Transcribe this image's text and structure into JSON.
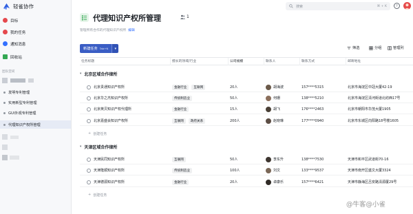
{
  "app": {
    "name": "轻雀协作"
  },
  "nav": [
    {
      "label": "目标",
      "color": "#e5484d"
    },
    {
      "label": "我的任务",
      "color": "#e5484d"
    },
    {
      "label": "通知消息",
      "color": "#3370ff"
    },
    {
      "label": "回收站",
      "color": "#34a853"
    }
  ],
  "sidebar": {
    "section_label": "团队空间",
    "projects": [
      {
        "label": "发明专利管理",
        "active": false
      },
      {
        "label": "实用新型专利管理",
        "active": false
      },
      {
        "label": "GUI外观专利管理",
        "active": false
      },
      {
        "label": "代理知识产权所管理",
        "active": true
      }
    ]
  },
  "topbar": {
    "search_placeholder": "搜索",
    "search_shortcut": "⌘ + K",
    "help_label": "?"
  },
  "header": {
    "title": "代理知识产权所管理",
    "member_count": "1",
    "subtitle": "管理所有合作的代理知识产权所",
    "edit_label": "编辑"
  },
  "toolbar": {
    "new_task_label": "新建任务",
    "new_task_shortcut": "Tab+N",
    "filter_label": "筛选",
    "group_label": "分组",
    "manage_columns_label": "管理列"
  },
  "table": {
    "columns": [
      "任务标题",
      "擅长的领域/行业",
      "公司规模",
      "联系人",
      "联系方式",
      "邮寄地址"
    ],
    "add_task_label": "创建任务",
    "groups": [
      {
        "name": "北京区域合作律所",
        "rows": [
          {
            "title": "北京贵通知识产权所",
            "tags": [
              "金融行业",
              "互联网"
            ],
            "size": "20人",
            "contact": "胡海波",
            "phone": "157****5315",
            "address": "北京市海淀区中冠大厦42-19"
          },
          {
            "title": "北京华之杰知识产权所",
            "tags": [
              "传统制造业"
            ],
            "size": "50人",
            "contact": "何珊",
            "phone": "138****5210",
            "address": "北京市海淀区清河街道北纺西17号"
          },
          {
            "title": "北京英贝知识产权代理所",
            "tags": [
              "金融行业"
            ],
            "size": "15人",
            "contact": "胡飞",
            "phone": "176****2463",
            "address": "北京市朝阳市华茂大厦1905"
          },
          {
            "title": "北京嘉盛会知识产权所",
            "tags": [
              "互联网",
              "政府关系"
            ],
            "size": "200人",
            "contact": "赵晓琳",
            "phone": "177****0940",
            "address": "北京市东城区向阳路18号楼1605"
          }
        ]
      },
      {
        "name": "天津区域合作律所",
        "rows": [
          {
            "title": "天津民同知识产权所",
            "tags": [
              "互联网"
            ],
            "size": "50人",
            "contact": "李东升",
            "phone": "138****7530",
            "address": "天津市和平区武道街70-16"
          },
          {
            "title": "天津隆顺知识产权所",
            "tags": [
              "传统制造业"
            ],
            "size": "100人",
            "contact": "刘文",
            "phone": "133****9537",
            "address": "天津市南开区盛文大厦3324"
          },
          {
            "title": "天津德源知识产权所",
            "tags": [
              "金融行业"
            ],
            "size": "20人",
            "contact": "卓康乐",
            "phone": "157****6421",
            "address": "天津市静海区吕安路清源厦29号"
          }
        ]
      }
    ]
  },
  "watermark": "@牛客@小雀"
}
